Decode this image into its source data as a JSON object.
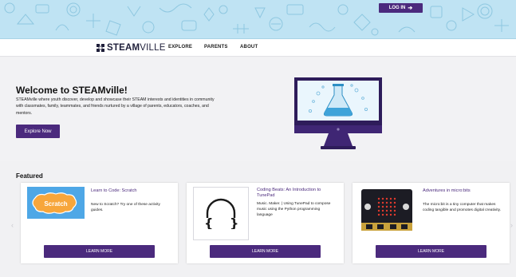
{
  "header": {
    "login_label": "LOG IN"
  },
  "nav": {
    "logo_bold": "STEAM",
    "logo_light": "VILLE",
    "links": [
      "EXPLORE",
      "PARENTS",
      "ABOUT"
    ]
  },
  "hero": {
    "title": "Welcome to STEAMville!",
    "description": "STEAMville where youth discover, develop and showcase their STEAM interests and identities in community with classmates, family, teammates, and friends nurtured by a village of parents, educators, coaches, and mentors.",
    "button_label": "Explore Now"
  },
  "featured": {
    "title": "Featured",
    "cards": [
      {
        "title": "Learn to Code: Scratch",
        "description": "New to Scratch? Try one of these activity guides.",
        "button_label": "LEARN MORE",
        "image_text": "Scratch"
      },
      {
        "title": "Coding Beats: An Introduction to TunePad",
        "description": "Music. Maker. | Using TunePad to compose music using the Python programming language",
        "button_label": "LEARN MORE"
      },
      {
        "title": "Adventures in micro:bits",
        "description": "The micro:bit is a tiny computer that makes coding tangible and promotes digital creativity.",
        "button_label": "LEARN MORE"
      }
    ]
  },
  "colors": {
    "brand_purple": "#4b2a7d",
    "banner_blue": "#bfe3f3",
    "page_bg": "#f2f2f4"
  },
  "icons": [
    "login-icon",
    "steamville-logo-icon",
    "monitor-flask-illustration",
    "scratch-logo",
    "tunepad-headphones-icon",
    "microbit-board-image",
    "carousel-left-arrow-icon",
    "carousel-right-arrow-icon"
  ]
}
